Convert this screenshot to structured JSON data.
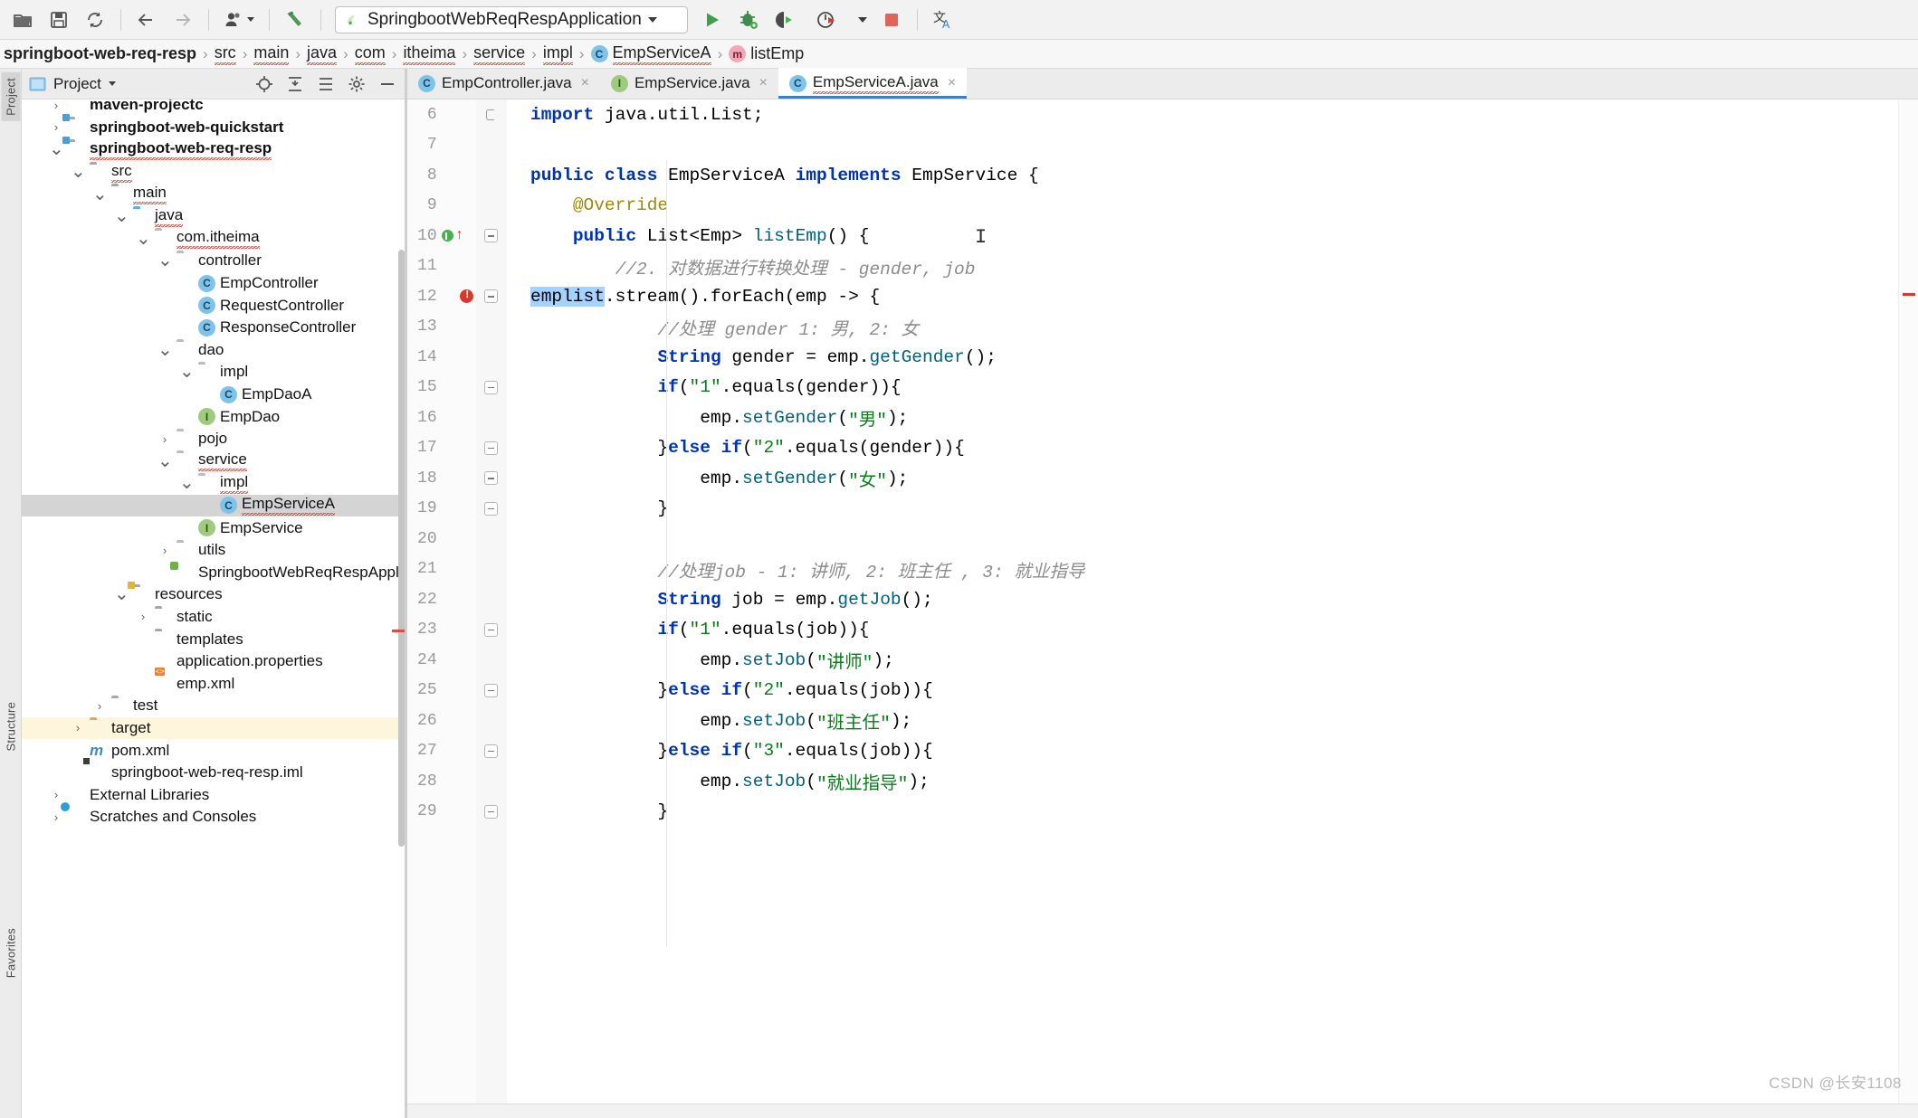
{
  "toolbar": {
    "icons": [
      "open-folder-icon",
      "save-all-icon",
      "sync-refresh-icon",
      "back-arrow-icon",
      "forward-arrow-icon",
      "profile-icon",
      "build-hammer-icon"
    ],
    "run_config_name": "SpringbootWebReqRespApplication",
    "run_label": "run-icon",
    "debug_label": "debug-icon",
    "run_coverage_label": "run-with-coverage-icon",
    "profiler_label": "profiler-icon",
    "stop_label": "stop-icon",
    "translate_label": "translate-icon"
  },
  "breadcrumb": {
    "items": [
      {
        "label": "springboot-web-req-resp",
        "icon": "",
        "bold": true,
        "squiggle": false
      },
      {
        "label": "src",
        "icon": "",
        "bold": false,
        "squiggle": true
      },
      {
        "label": "main",
        "icon": "",
        "bold": false,
        "squiggle": true
      },
      {
        "label": "java",
        "icon": "",
        "bold": false,
        "squiggle": true
      },
      {
        "label": "com",
        "icon": "",
        "bold": false,
        "squiggle": true
      },
      {
        "label": "itheima",
        "icon": "",
        "bold": false,
        "squiggle": true
      },
      {
        "label": "service",
        "icon": "",
        "bold": false,
        "squiggle": true
      },
      {
        "label": "impl",
        "icon": "",
        "bold": false,
        "squiggle": true
      },
      {
        "label": "EmpServiceA",
        "icon": "class-icon",
        "bold": false,
        "squiggle": true
      },
      {
        "label": "listEmp",
        "icon": "method-icon",
        "bold": false,
        "squiggle": false
      }
    ],
    "separator": "›"
  },
  "tool_strip": {
    "labels": [
      "Project",
      "Structure",
      "Favorites"
    ]
  },
  "project_panel": {
    "title": "Project",
    "header_icons": [
      "locate-target-icon",
      "expand-all-icon",
      "collapse-all-icon",
      "settings-gear-icon",
      "hide-minimize-icon"
    ],
    "tree": [
      {
        "label": "maven-projectc",
        "depth": 1,
        "arrow": "collapsed",
        "icon": "module-folder",
        "bold": true,
        "squiggle": false,
        "state": "clipped"
      },
      {
        "label": "springboot-web-quickstart",
        "depth": 1,
        "arrow": "collapsed",
        "icon": "module-folder",
        "bold": true,
        "squiggle": false
      },
      {
        "label": "springboot-web-req-resp",
        "depth": 1,
        "arrow": "expanded",
        "icon": "module-folder",
        "bold": true,
        "squiggle": true
      },
      {
        "label": "src",
        "depth": 2,
        "arrow": "expanded",
        "icon": "folder-grey",
        "bold": false,
        "squiggle": true
      },
      {
        "label": "main",
        "depth": 3,
        "arrow": "expanded",
        "icon": "folder-grey",
        "bold": false,
        "squiggle": true
      },
      {
        "label": "java",
        "depth": 4,
        "arrow": "expanded",
        "icon": "folder-source-blue",
        "bold": false,
        "squiggle": true
      },
      {
        "label": "com.itheima",
        "depth": 5,
        "arrow": "expanded",
        "icon": "package",
        "bold": false,
        "squiggle": true
      },
      {
        "label": "controller",
        "depth": 6,
        "arrow": "expanded",
        "icon": "package",
        "bold": false,
        "squiggle": false
      },
      {
        "label": "EmpController",
        "depth": 7,
        "arrow": "none",
        "icon": "class",
        "bold": false,
        "squiggle": false
      },
      {
        "label": "RequestController",
        "depth": 7,
        "arrow": "none",
        "icon": "class",
        "bold": false,
        "squiggle": false
      },
      {
        "label": "ResponseController",
        "depth": 7,
        "arrow": "none",
        "icon": "class",
        "bold": false,
        "squiggle": false
      },
      {
        "label": "dao",
        "depth": 6,
        "arrow": "expanded",
        "icon": "package",
        "bold": false,
        "squiggle": false
      },
      {
        "label": "impl",
        "depth": 7,
        "arrow": "expanded",
        "icon": "package",
        "bold": false,
        "squiggle": false
      },
      {
        "label": "EmpDaoA",
        "depth": 8,
        "arrow": "none",
        "icon": "class",
        "bold": false,
        "squiggle": false
      },
      {
        "label": "EmpDao",
        "depth": 7,
        "arrow": "none",
        "icon": "interface",
        "bold": false,
        "squiggle": false
      },
      {
        "label": "pojo",
        "depth": 6,
        "arrow": "collapsed",
        "icon": "package",
        "bold": false,
        "squiggle": false
      },
      {
        "label": "service",
        "depth": 6,
        "arrow": "expanded",
        "icon": "package",
        "bold": false,
        "squiggle": true
      },
      {
        "label": "impl",
        "depth": 7,
        "arrow": "expanded",
        "icon": "package",
        "bold": false,
        "squiggle": true
      },
      {
        "label": "EmpServiceA",
        "depth": 8,
        "arrow": "none",
        "icon": "class",
        "bold": false,
        "squiggle": true,
        "selected": true
      },
      {
        "label": "EmpService",
        "depth": 7,
        "arrow": "none",
        "icon": "interface",
        "bold": false,
        "squiggle": false
      },
      {
        "label": "utils",
        "depth": 6,
        "arrow": "collapsed",
        "icon": "package",
        "bold": false,
        "squiggle": false
      },
      {
        "label": "SpringbootWebReqRespApplication",
        "depth": 6,
        "arrow": "none",
        "icon": "spring-class",
        "bold": false,
        "squiggle": false
      },
      {
        "label": "resources",
        "depth": 4,
        "arrow": "expanded",
        "icon": "folder-resources",
        "bold": false,
        "squiggle": false
      },
      {
        "label": "static",
        "depth": 5,
        "arrow": "collapsed",
        "icon": "folder-grey",
        "bold": false,
        "squiggle": false
      },
      {
        "label": "templates",
        "depth": 5,
        "arrow": "none",
        "icon": "folder-grey",
        "bold": false,
        "squiggle": false
      },
      {
        "label": "application.properties",
        "depth": 5,
        "arrow": "none",
        "icon": "spring-leaf",
        "bold": false,
        "squiggle": false
      },
      {
        "label": "emp.xml",
        "depth": 5,
        "arrow": "none",
        "icon": "xml-file",
        "bold": false,
        "squiggle": false
      },
      {
        "label": "test",
        "depth": 3,
        "arrow": "collapsed",
        "icon": "folder-grey",
        "bold": false,
        "squiggle": false
      },
      {
        "label": "target",
        "depth": 2,
        "arrow": "collapsed",
        "icon": "folder-orange",
        "bold": false,
        "squiggle": false,
        "highlight": true
      },
      {
        "label": "pom.xml",
        "depth": 2,
        "arrow": "none",
        "icon": "maven-file",
        "bold": false,
        "squiggle": false
      },
      {
        "label": "springboot-web-req-resp.iml",
        "depth": 2,
        "arrow": "none",
        "icon": "iml-file",
        "bold": false,
        "squiggle": false
      },
      {
        "label": "External Libraries",
        "depth": 1,
        "arrow": "collapsed",
        "icon": "libraries",
        "bold": false,
        "squiggle": false
      },
      {
        "label": "Scratches and Consoles",
        "depth": 1,
        "arrow": "collapsed",
        "icon": "scratches",
        "bold": false,
        "squiggle": false
      }
    ]
  },
  "editor": {
    "tabs": [
      {
        "label": "EmpController.java",
        "icon": "class-icon",
        "active": false,
        "closable": true
      },
      {
        "label": "EmpService.java",
        "icon": "interface-icon",
        "active": false,
        "closable": true
      },
      {
        "label": "EmpServiceA.java",
        "icon": "class-icon",
        "active": true,
        "closable": true
      }
    ],
    "first_line_number": 6,
    "lines": [
      {
        "n": 6,
        "fold": "brace",
        "marker": "",
        "tokens": [
          [
            "kw",
            "import "
          ],
          [
            "plain",
            "java.util.List;"
          ]
        ]
      },
      {
        "n": 7,
        "fold": "",
        "marker": "",
        "tokens": []
      },
      {
        "n": 8,
        "fold": "",
        "marker": "",
        "tokens": [
          [
            "kw",
            "public class "
          ],
          [
            "typ",
            "EmpServiceA "
          ],
          [
            "kw",
            "implements "
          ],
          [
            "typ",
            "EmpService "
          ],
          [
            "plain",
            "{"
          ]
        ]
      },
      {
        "n": 9,
        "fold": "",
        "marker": "",
        "tokens": [
          [
            "plain",
            "    "
          ],
          [
            "anno",
            "@Override"
          ]
        ]
      },
      {
        "n": 10,
        "fold": "fold",
        "marker": "implemented",
        "tokens": [
          [
            "plain",
            "    "
          ],
          [
            "kw",
            "public "
          ],
          [
            "typ",
            "List<Emp> "
          ],
          [
            "mth",
            "listEmp"
          ],
          [
            "plain",
            "() {"
          ]
        ]
      },
      {
        "n": 11,
        "fold": "",
        "marker": "",
        "tokens": [
          [
            "cmt",
            "        //2. 对数据进行转换处理 - gender, job"
          ]
        ]
      },
      {
        "n": 12,
        "fold": "fold",
        "marker": "error",
        "tokens": [
          [
            "hl",
            "emplist"
          ],
          [
            "plain",
            ".stream().forEach(emp -> {"
          ]
        ]
      },
      {
        "n": 13,
        "fold": "",
        "marker": "",
        "tokens": [
          [
            "cmt",
            "            //处理 gender 1: 男, 2: 女"
          ]
        ]
      },
      {
        "n": 14,
        "fold": "",
        "marker": "",
        "tokens": [
          [
            "plain",
            "            "
          ],
          [
            "kw",
            "String "
          ],
          [
            "plain",
            "gender = emp."
          ],
          [
            "mth",
            "getGender"
          ],
          [
            "plain",
            "();"
          ]
        ]
      },
      {
        "n": 15,
        "fold": "fold",
        "marker": "",
        "tokens": [
          [
            "plain",
            "            "
          ],
          [
            "kw",
            "if"
          ],
          [
            "plain",
            "("
          ],
          [
            "str",
            "\"1\""
          ],
          [
            "plain",
            ".equals(gender)){"
          ]
        ]
      },
      {
        "n": 16,
        "fold": "",
        "marker": "",
        "tokens": [
          [
            "plain",
            "                emp."
          ],
          [
            "mth",
            "setGender"
          ],
          [
            "plain",
            "("
          ],
          [
            "str",
            "\"男\""
          ],
          [
            "plain",
            ");"
          ]
        ]
      },
      {
        "n": 17,
        "fold": "fold",
        "marker": "",
        "tokens": [
          [
            "plain",
            "            }"
          ],
          [
            "kw",
            "else if"
          ],
          [
            "plain",
            "("
          ],
          [
            "str",
            "\"2\""
          ],
          [
            "plain",
            ".equals(gender)){"
          ]
        ]
      },
      {
        "n": 18,
        "fold": "fold",
        "marker": "",
        "tokens": [
          [
            "plain",
            "                emp."
          ],
          [
            "mth",
            "setGender"
          ],
          [
            "plain",
            "("
          ],
          [
            "str",
            "\"女\""
          ],
          [
            "plain",
            ");"
          ]
        ]
      },
      {
        "n": 19,
        "fold": "fold",
        "marker": "",
        "tokens": [
          [
            "plain",
            "            }"
          ]
        ]
      },
      {
        "n": 20,
        "fold": "",
        "marker": "",
        "tokens": []
      },
      {
        "n": 21,
        "fold": "",
        "marker": "",
        "tokens": [
          [
            "cmt",
            "            //处理job - 1: 讲师, 2: 班主任 , 3: 就业指导"
          ]
        ]
      },
      {
        "n": 22,
        "fold": "",
        "marker": "",
        "tokens": [
          [
            "plain",
            "            "
          ],
          [
            "kw",
            "String "
          ],
          [
            "plain",
            "job = emp."
          ],
          [
            "mth",
            "getJob"
          ],
          [
            "plain",
            "();"
          ]
        ]
      },
      {
        "n": 23,
        "fold": "fold",
        "marker": "",
        "tokens": [
          [
            "plain",
            "            "
          ],
          [
            "kw",
            "if"
          ],
          [
            "plain",
            "("
          ],
          [
            "str",
            "\"1\""
          ],
          [
            "plain",
            ".equals(job)){"
          ]
        ]
      },
      {
        "n": 24,
        "fold": "",
        "marker": "",
        "tokens": [
          [
            "plain",
            "                emp."
          ],
          [
            "mth",
            "setJob"
          ],
          [
            "plain",
            "("
          ],
          [
            "str",
            "\"讲师\""
          ],
          [
            "plain",
            ");"
          ]
        ]
      },
      {
        "n": 25,
        "fold": "fold",
        "marker": "",
        "tokens": [
          [
            "plain",
            "            }"
          ],
          [
            "kw",
            "else if"
          ],
          [
            "plain",
            "("
          ],
          [
            "str",
            "\"2\""
          ],
          [
            "plain",
            ".equals(job)){"
          ]
        ]
      },
      {
        "n": 26,
        "fold": "",
        "marker": "",
        "tokens": [
          [
            "plain",
            "                emp."
          ],
          [
            "mth",
            "setJob"
          ],
          [
            "plain",
            "("
          ],
          [
            "str",
            "\"班主任\""
          ],
          [
            "plain",
            ");"
          ]
        ]
      },
      {
        "n": 27,
        "fold": "fold",
        "marker": "",
        "tokens": [
          [
            "plain",
            "            }"
          ],
          [
            "kw",
            "else if"
          ],
          [
            "plain",
            "("
          ],
          [
            "str",
            "\"3\""
          ],
          [
            "plain",
            ".equals(job)){"
          ]
        ]
      },
      {
        "n": 28,
        "fold": "",
        "marker": "",
        "tokens": [
          [
            "plain",
            "                emp."
          ],
          [
            "mth",
            "setJob"
          ],
          [
            "plain",
            "("
          ],
          [
            "str",
            "\"就业指导\""
          ],
          [
            "plain",
            ");"
          ]
        ]
      },
      {
        "n": 29,
        "fold": "fold",
        "marker": "",
        "tokens": [
          [
            "plain",
            "            }"
          ]
        ]
      }
    ]
  },
  "watermark": "CSDN @长安1108",
  "colors": {
    "keyword": "#0033b3",
    "string": "#067d17",
    "comment": "#8c8c8c",
    "annotation": "#9e880d",
    "method": "#00627a",
    "selection": "#a6d2ff",
    "tab_underline": "#3d7fc1",
    "error": "#d9392b",
    "run_green": "#4caf50",
    "target_highlight": "#fdf6dd"
  }
}
